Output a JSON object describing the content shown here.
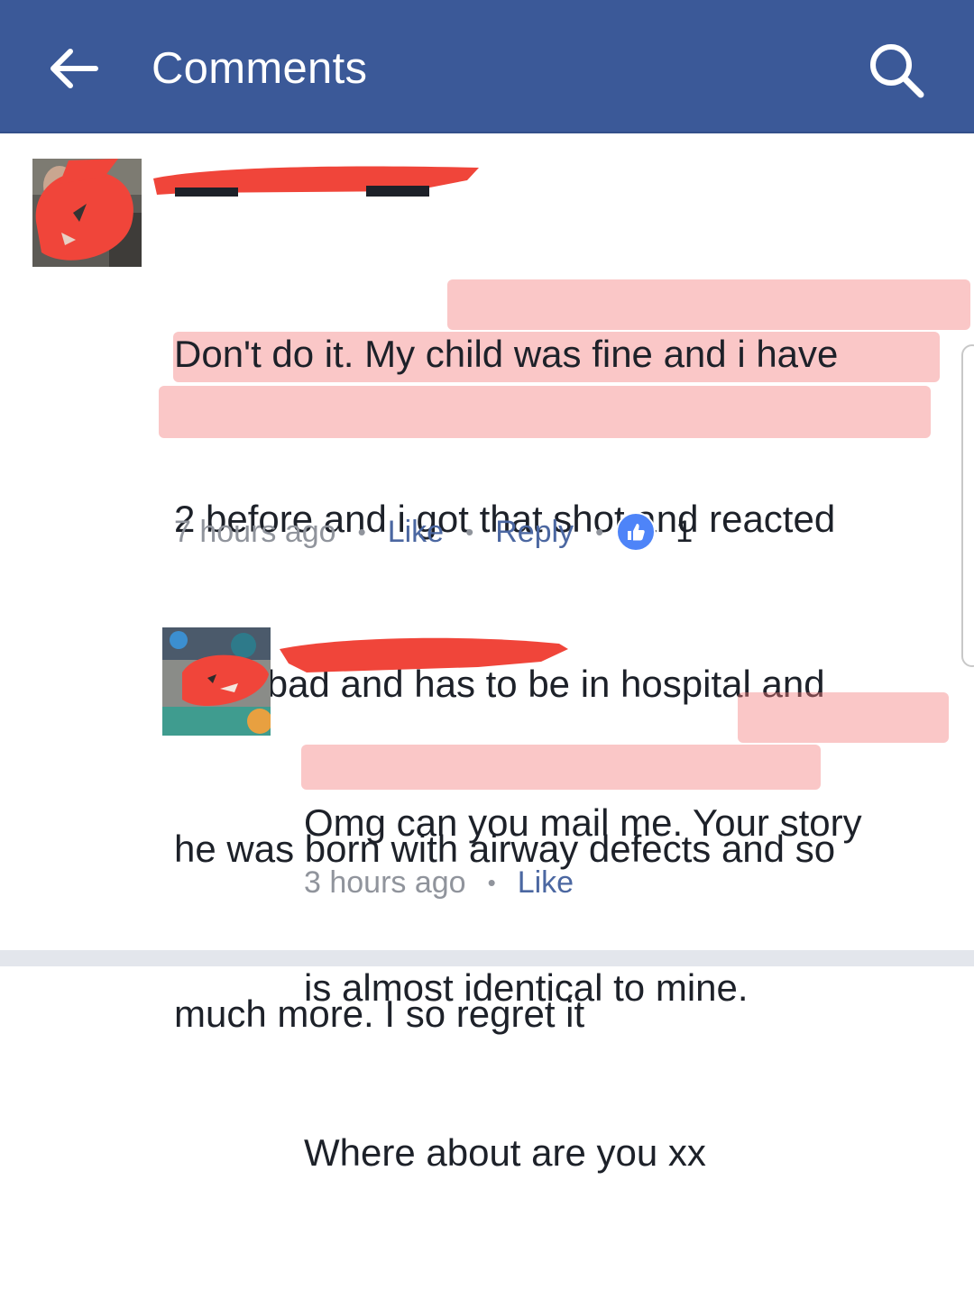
{
  "header": {
    "title": "Comments",
    "back_icon": "arrow-left-icon",
    "search_icon": "search-icon",
    "background": "#3b5998"
  },
  "comments": [
    {
      "lines": [
        "Don't do it. My child was fine and i have",
        "2 before and i got that shot and reacted",
        "sooo bad and has to be in hospital and",
        "he was born with airway defects and so",
        "much more. I so regret it"
      ],
      "time": "7 hours ago",
      "like_label": "Like",
      "reply_label": "Reply",
      "reaction_icon": "thumbs-up-icon",
      "reaction_count": "1"
    },
    {
      "lines": [
        "Omg can you mail me. Your story",
        "is almost identical to mine.",
        "Where about are you xx"
      ],
      "time": "3 hours ago",
      "like_label": "Like"
    }
  ],
  "colors": {
    "redaction": "#f0453a",
    "highlight": "#f47a7a",
    "link": "#4b67a1",
    "reaction": "#4e84f8"
  }
}
